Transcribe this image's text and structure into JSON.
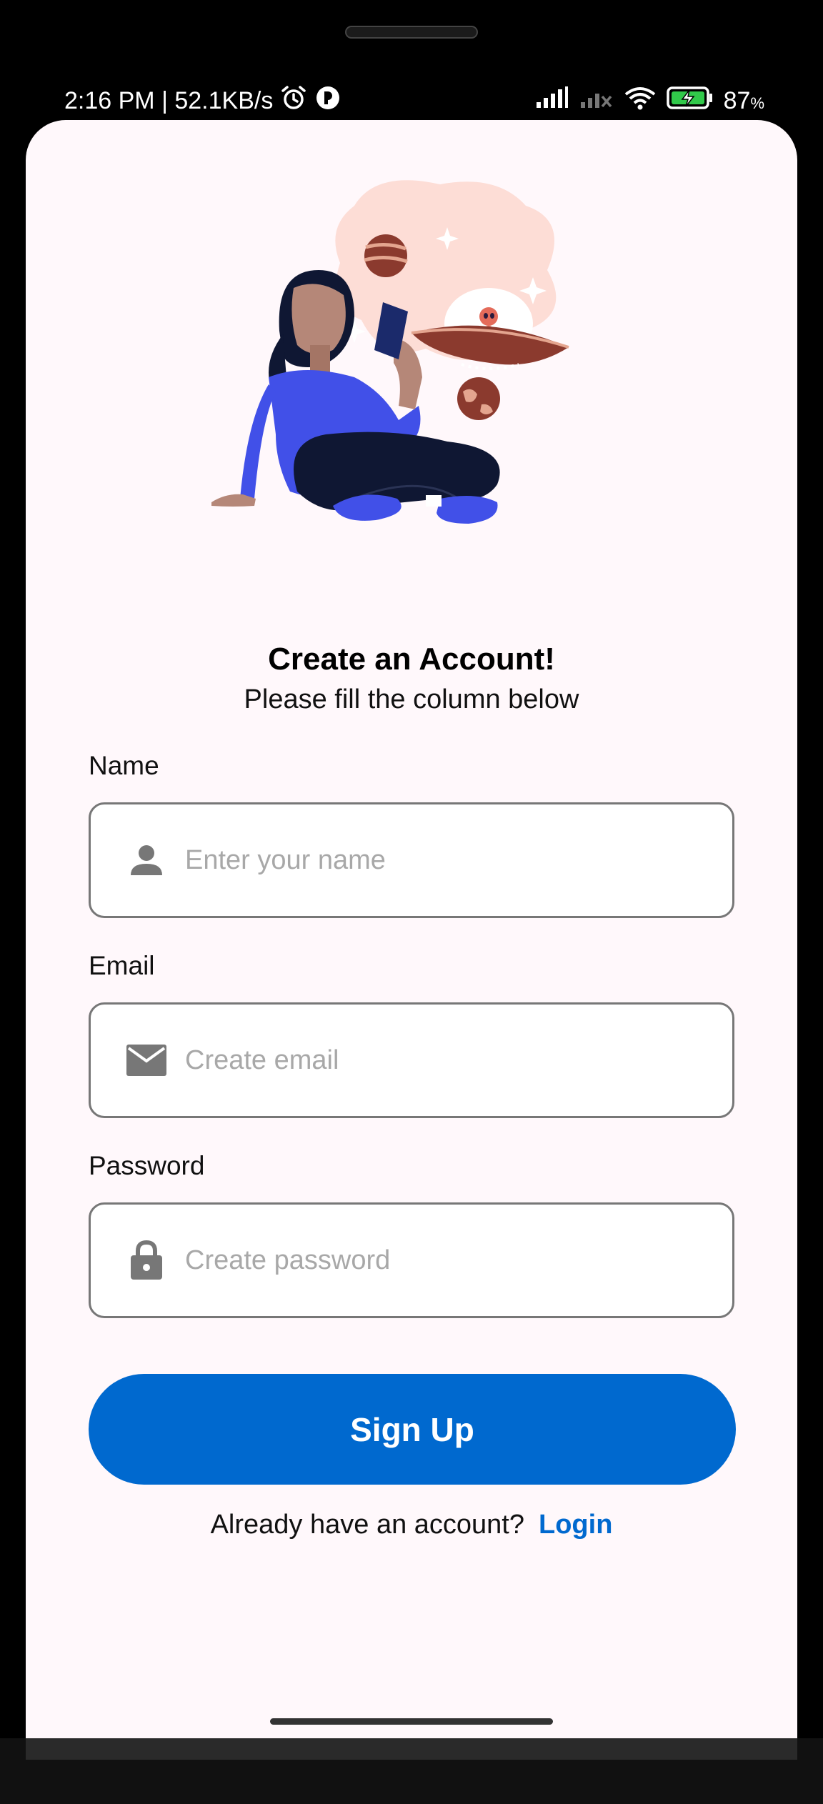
{
  "status_bar": {
    "time_speed": "2:16 PM | 52.1KB/s",
    "battery_percent": "87",
    "battery_unit": "%",
    "icons": [
      "alarm-icon",
      "app-notification-icon",
      "signal-icon",
      "no-signal-icon",
      "wifi-icon",
      "battery-charging-icon"
    ]
  },
  "header": {
    "title": "Create an Account!",
    "subtitle": "Please fill the column below"
  },
  "form": {
    "name": {
      "label": "Name",
      "placeholder": "Enter your name",
      "icon": "person-icon",
      "value": ""
    },
    "email": {
      "label": "Email",
      "placeholder": "Create email",
      "icon": "mail-icon",
      "value": ""
    },
    "password": {
      "label": "Password",
      "placeholder": "Create password",
      "icon": "lock-icon",
      "value": ""
    },
    "submit_label": "Sign Up"
  },
  "footer": {
    "prompt": "Already have an account?",
    "link_label": "Login"
  },
  "colors": {
    "primary": "#0069cf",
    "background": "#fff8fb",
    "field_border": "#777777",
    "placeholder": "#a8a8a8"
  }
}
